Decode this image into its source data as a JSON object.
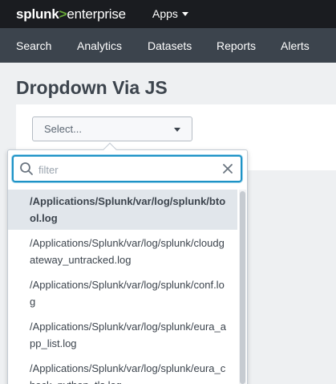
{
  "topbar": {
    "logo_part1": "splunk",
    "logo_part2": ">",
    "logo_part3": "enterprise",
    "apps_label": "Apps"
  },
  "nav": {
    "items": [
      {
        "label": "Search"
      },
      {
        "label": "Analytics"
      },
      {
        "label": "Datasets"
      },
      {
        "label": "Reports"
      },
      {
        "label": "Alerts"
      }
    ]
  },
  "page": {
    "title": "Dropdown Via JS"
  },
  "select": {
    "label": "Select..."
  },
  "dropdown": {
    "filter_placeholder": "filter",
    "filter_value": "",
    "items": [
      {
        "label": "/Applications/Splunk/var/log/splunk/btool.log",
        "selected": true
      },
      {
        "label": "/Applications/Splunk/var/log/splunk/cloudgateway_untracked.log",
        "selected": false
      },
      {
        "label": "/Applications/Splunk/var/log/splunk/conf.log",
        "selected": false
      },
      {
        "label": "/Applications/Splunk/var/log/splunk/eura_app_list.log",
        "selected": false
      },
      {
        "label": "/Applications/Splunk/var/log/splunk/eura_check_python_tls.log",
        "selected": false
      }
    ]
  },
  "colors": {
    "topbar_bg": "#1a1c20",
    "navbar_bg": "#3c444d",
    "brand_green": "#65a637",
    "focus_blue": "#1e93c6",
    "selected_bg": "#e1e6eb"
  }
}
